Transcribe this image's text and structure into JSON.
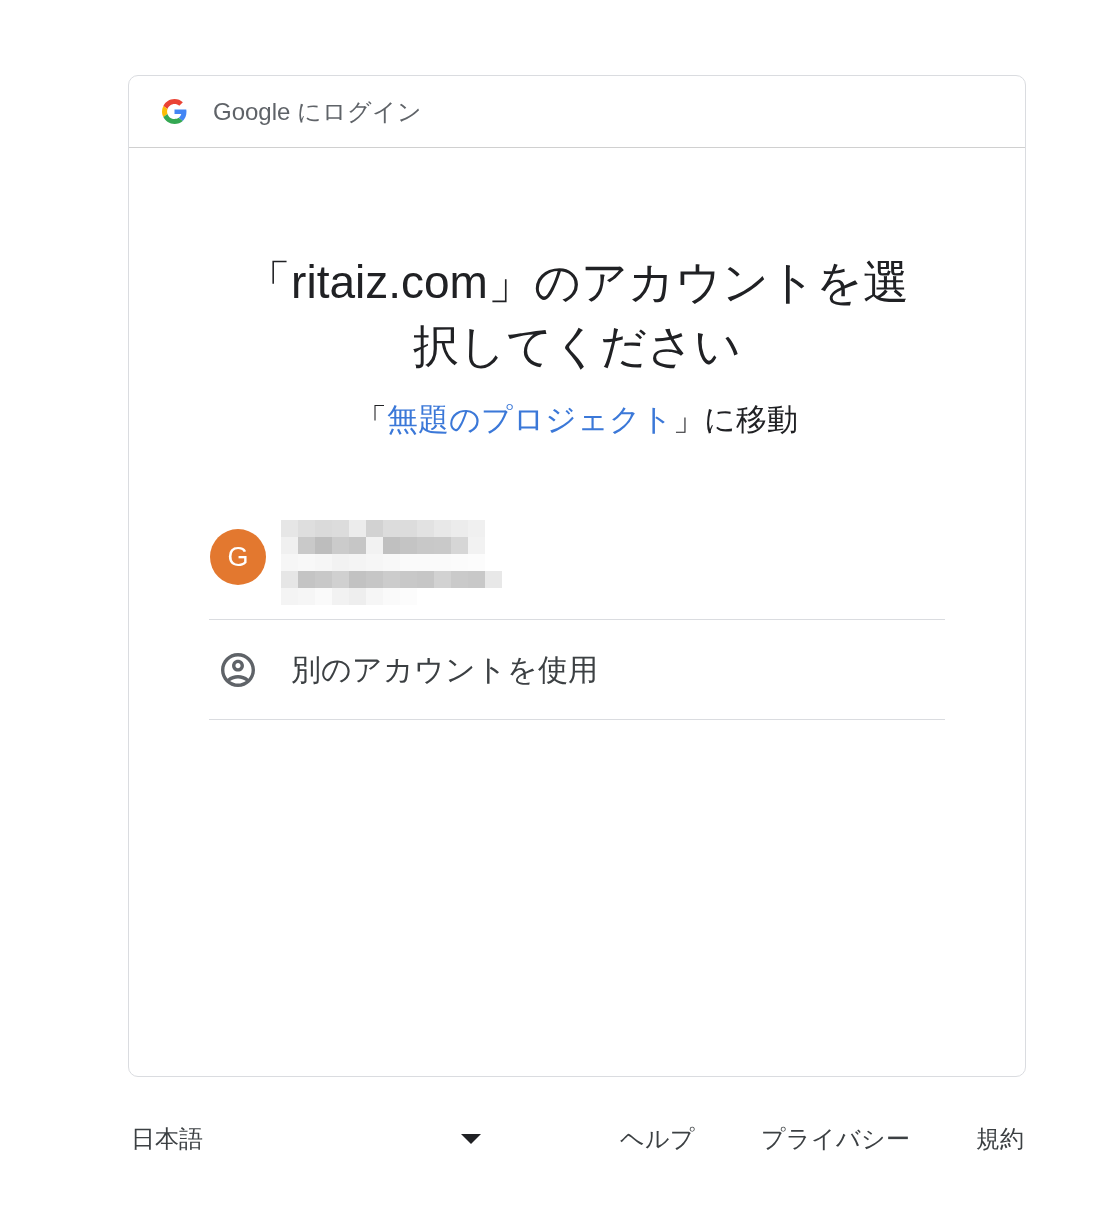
{
  "header": {
    "title": "Google にログイン"
  },
  "heading": "「ritaiz.com」のアカウントを選択してください",
  "subheading": {
    "before": "「",
    "link": "無題のプロジェクト",
    "after": "」に移動"
  },
  "accounts": [
    {
      "initial": "G",
      "color": "#e3782f",
      "redacted": true
    }
  ],
  "other_account": {
    "label": "別のアカウントを使用"
  },
  "footer": {
    "language": "日本語",
    "links": [
      "ヘルプ",
      "プライバシー",
      "規約"
    ]
  }
}
